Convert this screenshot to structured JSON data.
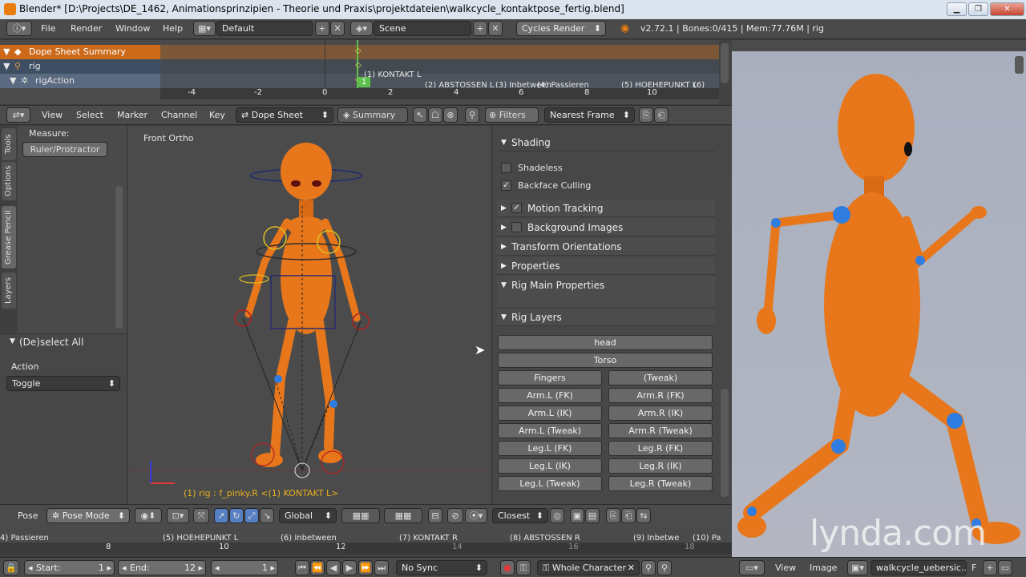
{
  "window": {
    "title": "Blender* [D:\\Projects\\DE_1462, Animationsprinzipien - Theorie und Praxis\\projektdateien\\walkcycle_kontaktpose_fertig.blend]",
    "min": "▁",
    "max": "❐",
    "close": "✕"
  },
  "info_header": {
    "menus": [
      "File",
      "Render",
      "Window",
      "Help"
    ],
    "screen_layout": "Default",
    "scene": "Scene",
    "render_engine": "Cycles Render",
    "stats": "v2.72.1 | Bones:0/415 | Mem:77.76M | rig"
  },
  "dopesheet": {
    "channels": [
      {
        "label": "Dope Sheet Summary"
      },
      {
        "label": "rig"
      },
      {
        "label": "rigAction"
      }
    ],
    "frame_ticks": [
      "-4",
      "-2",
      "0",
      "2",
      "4",
      "6",
      "8",
      "10"
    ],
    "markers": [
      "(1) KONTAKT L",
      "(2) ABSTOSSEN L",
      "(3) Inbetween",
      "(4) Passieren",
      "(5) HOEHEPUNKT L",
      "(6) Inb"
    ],
    "current_frame": "1"
  },
  "dopesheet_header": {
    "menus": [
      "View",
      "Select",
      "Marker",
      "Channel",
      "Key"
    ],
    "mode": "Dope Sheet",
    "summary_label": "Summary",
    "filters_label": "Filters",
    "snap": "Nearest Frame"
  },
  "tool_shelf": {
    "tabs": [
      "Tools",
      "Options",
      "Grease Pencil",
      "Layers"
    ],
    "measure_label": "Measure:",
    "ruler_button": "Ruler/Protractor",
    "operator_title": "(De)select All",
    "action_label": "Action",
    "action_value": "Toggle"
  },
  "viewport": {
    "view_label": "Front Ortho",
    "status": "(1) rig : f_pinky.R <(1) KONTAKT L>"
  },
  "properties": {
    "shading_title": "Shading",
    "shadeless": "Shadeless",
    "backface": "Backface Culling",
    "motion_tracking": "Motion Tracking",
    "background_images": "Background Images",
    "transform_orientations": "Transform Orientations",
    "properties_title": "Properties",
    "rig_main": "Rig Main Properties",
    "rig_layers": "Rig Layers",
    "layer_buttons": {
      "head": "head",
      "torso": "Torso",
      "fingers": "Fingers",
      "tweak": "(Tweak)",
      "arml_fk": "Arm.L (FK)",
      "armr_fk": "Arm.R (FK)",
      "arml_ik": "Arm.L (IK)",
      "armr_ik": "Arm.R (IK)",
      "arml_tw": "Arm.L (Tweak)",
      "armr_tw": "Arm.R (Tweak)",
      "legl_fk": "Leg.L (FK)",
      "legr_fk": "Leg.R (FK)",
      "legl_ik": "Leg.L (IK)",
      "legr_ik": "Leg.R (IK)",
      "legl_tw": "Leg.L (Tweak)",
      "legr_tw": "Leg.R (Tweak)"
    }
  },
  "viewport_header": {
    "pose": "Pose",
    "mode": "Pose Mode",
    "orientation": "Global",
    "snap": "Closest"
  },
  "timeline": {
    "markers": [
      "4) Passieren",
      "(5) HOEHEPUNKT L",
      "(6) Inbetween",
      "(7) KONTAKT R",
      "(8) ABSTOSSEN R",
      "(9) Inbetwe",
      "(10) Pa"
    ],
    "ticks": [
      "8",
      "10",
      "12",
      "14",
      "16",
      "18"
    ]
  },
  "bottom": {
    "start_label": "Start:",
    "start_value": "1",
    "end_label": "End:",
    "end_value": "12",
    "current_frame": "1",
    "sync": "No Sync",
    "keying_set": "Whole Character",
    "image_view": "View",
    "image_menu": "Image",
    "image_name": "walkcycle_uebersic...",
    "image_f": "F"
  },
  "watermark": "lynda.com",
  "colors": {
    "accent": "#e87d0d",
    "character": "#e8771b",
    "joint": "#2f7de0",
    "selected_channel": "#cc6a1a"
  }
}
